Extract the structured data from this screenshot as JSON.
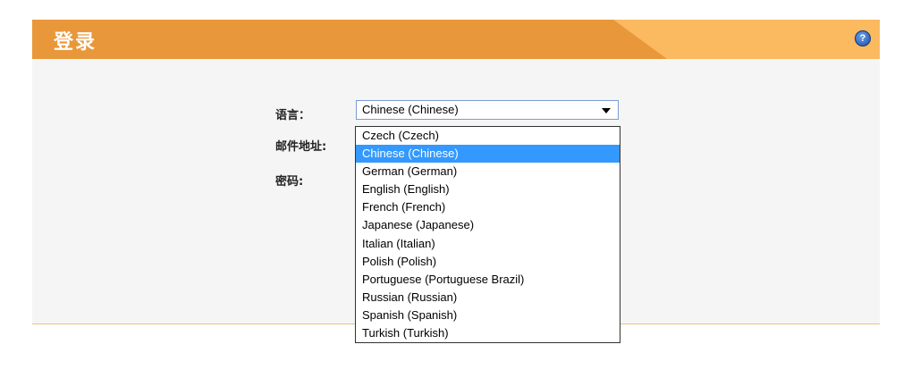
{
  "header": {
    "title": "登录",
    "help_icon": "help-icon"
  },
  "form": {
    "language_label": "语言：",
    "email_label": "邮件地址:",
    "password_label": "密码:",
    "language_selected": "Chinese (Chinese)"
  },
  "dropdown": {
    "selected_index": 1,
    "options": [
      "Czech (Czech)",
      "Chinese (Chinese)",
      "German (German)",
      "English (English)",
      "French (French)",
      "Japanese (Japanese)",
      "Italian (Italian)",
      "Polish (Polish)",
      "Portuguese (Portuguese Brazil)",
      "Russian (Russian)",
      "Spanish (Spanish)",
      "Turkish (Turkish)"
    ]
  },
  "colors": {
    "header_dark": "#e8983a",
    "header_light": "#fbb960",
    "selection": "#3399ff"
  }
}
